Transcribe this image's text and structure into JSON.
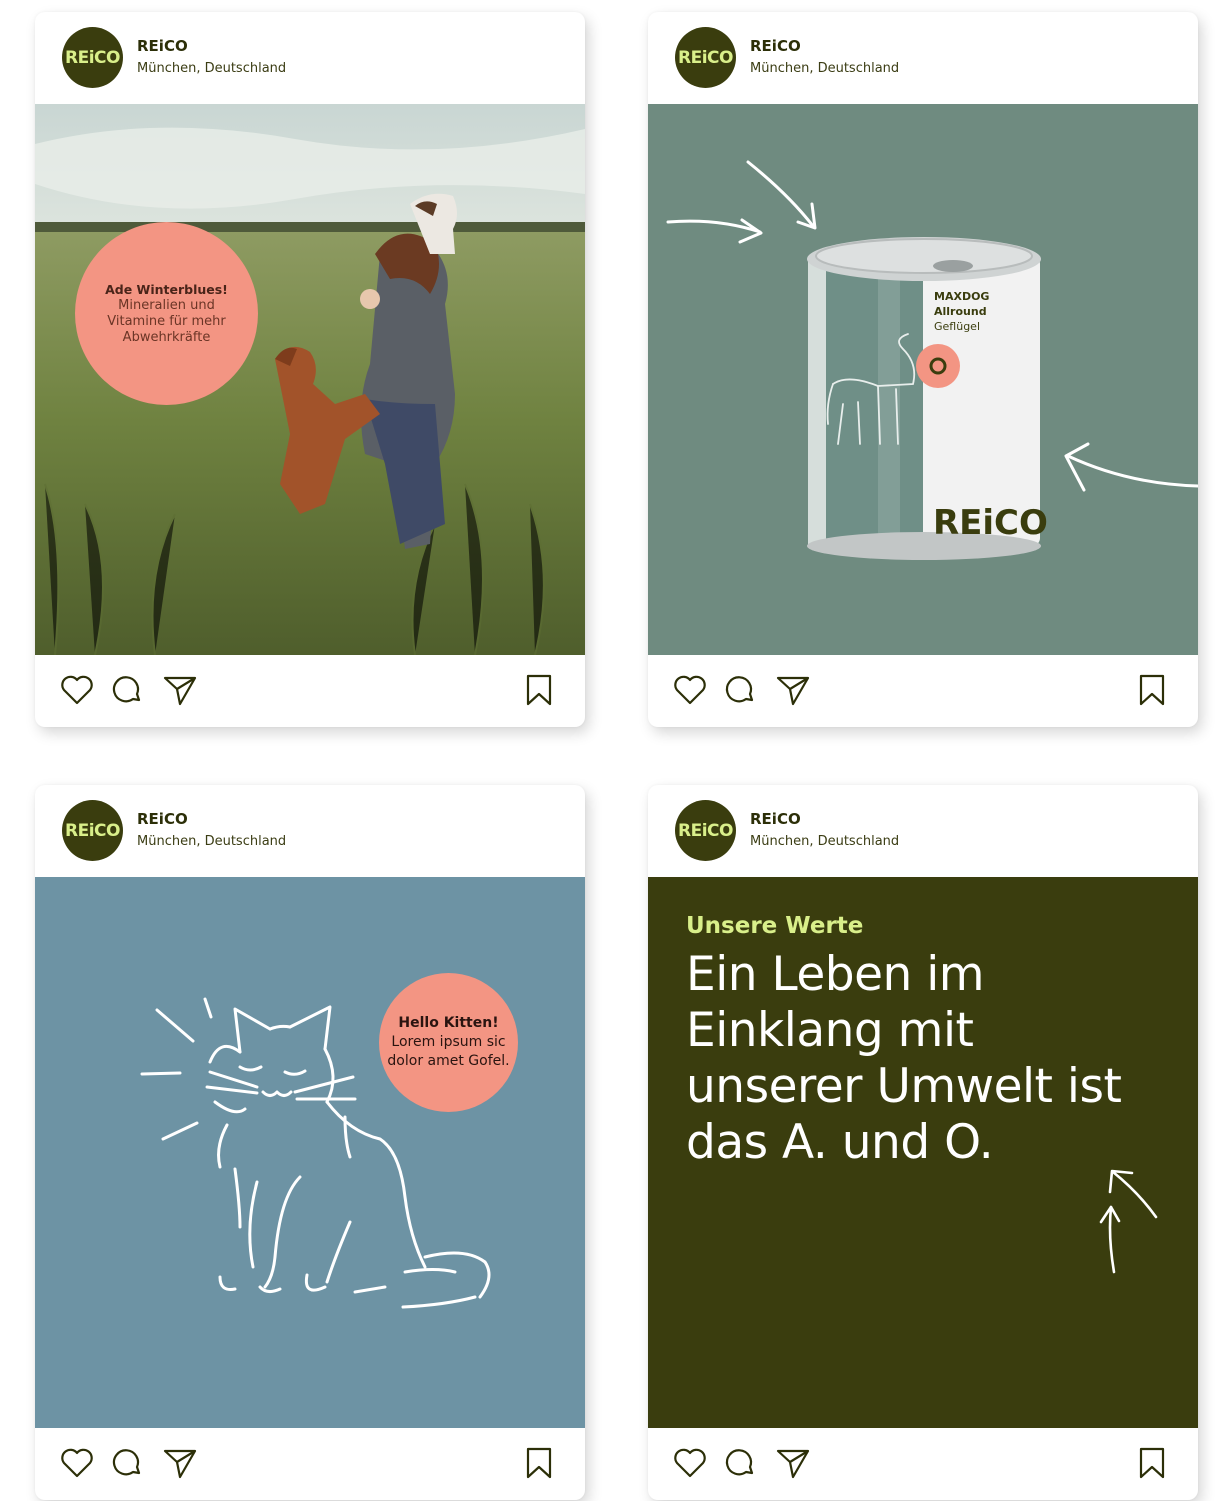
{
  "colors": {
    "brand_dark": "#3a3d0e",
    "brand_lime": "#d9ef8a",
    "badge_salmon": "#f39583",
    "sage_bg": "#6f8b80",
    "blue_bg": "#6d93a4"
  },
  "posts": [
    {
      "account": {
        "logo": "REiCO",
        "name": "REiCO",
        "location": "München, Deutschland"
      },
      "media": {
        "badge_title": "Ade Winterblues!",
        "badge_text": "Mineralien und Vitamine für mehr Abwehrkräfte"
      },
      "actions": {
        "icons": [
          "heart-icon",
          "comment-icon",
          "send-icon",
          "bookmark-icon"
        ]
      }
    },
    {
      "account": {
        "logo": "REiCO",
        "name": "REiCO",
        "location": "München, Deutschland"
      },
      "media": {
        "can_brand": "MAXDOG",
        "can_line": "Allround",
        "can_flavor": "Geflügel",
        "can_logo": "REiCO"
      },
      "actions": {
        "icons": [
          "heart-icon",
          "comment-icon",
          "send-icon",
          "bookmark-icon"
        ]
      }
    },
    {
      "account": {
        "logo": "REiCO",
        "name": "REiCO",
        "location": "München, Deutschland"
      },
      "media": {
        "badge_title": "Hello Kitten!",
        "badge_text": "Lorem ipsum sic dolor amet Gofel."
      },
      "actions": {
        "icons": [
          "heart-icon",
          "comment-icon",
          "send-icon",
          "bookmark-icon"
        ]
      }
    },
    {
      "account": {
        "logo": "REiCO",
        "name": "REiCO",
        "location": "München, Deutschland"
      },
      "media": {
        "kicker": "Unsere Werte",
        "headline": "Ein Leben im Einklang mit unserer Umwelt ist das A. und O."
      },
      "actions": {
        "icons": [
          "heart-icon",
          "comment-icon",
          "send-icon",
          "bookmark-icon"
        ]
      }
    }
  ]
}
